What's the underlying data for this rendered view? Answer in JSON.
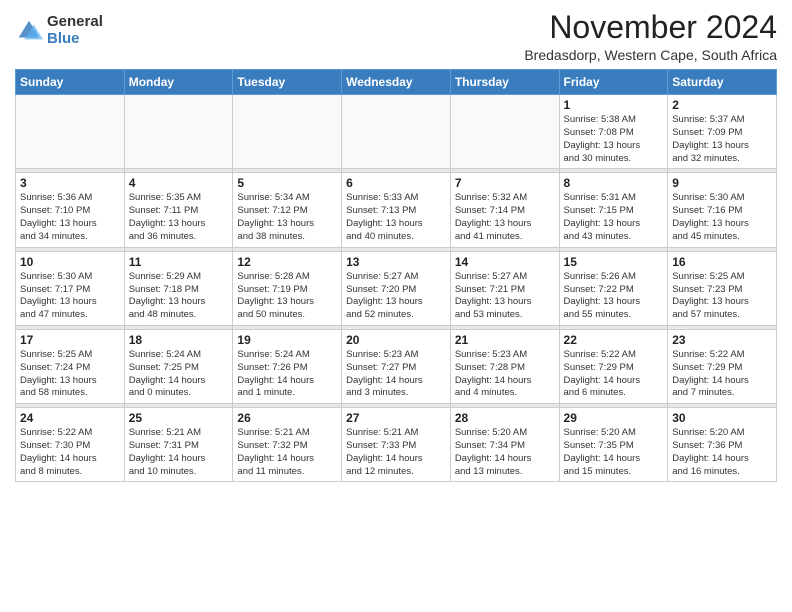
{
  "header": {
    "logo_general": "General",
    "logo_blue": "Blue",
    "month_title": "November 2024",
    "location": "Bredasdorp, Western Cape, South Africa"
  },
  "weekdays": [
    "Sunday",
    "Monday",
    "Tuesday",
    "Wednesday",
    "Thursday",
    "Friday",
    "Saturday"
  ],
  "weeks": [
    [
      {
        "day": "",
        "info": ""
      },
      {
        "day": "",
        "info": ""
      },
      {
        "day": "",
        "info": ""
      },
      {
        "day": "",
        "info": ""
      },
      {
        "day": "",
        "info": ""
      },
      {
        "day": "1",
        "info": "Sunrise: 5:38 AM\nSunset: 7:08 PM\nDaylight: 13 hours\nand 30 minutes."
      },
      {
        "day": "2",
        "info": "Sunrise: 5:37 AM\nSunset: 7:09 PM\nDaylight: 13 hours\nand 32 minutes."
      }
    ],
    [
      {
        "day": "3",
        "info": "Sunrise: 5:36 AM\nSunset: 7:10 PM\nDaylight: 13 hours\nand 34 minutes."
      },
      {
        "day": "4",
        "info": "Sunrise: 5:35 AM\nSunset: 7:11 PM\nDaylight: 13 hours\nand 36 minutes."
      },
      {
        "day": "5",
        "info": "Sunrise: 5:34 AM\nSunset: 7:12 PM\nDaylight: 13 hours\nand 38 minutes."
      },
      {
        "day": "6",
        "info": "Sunrise: 5:33 AM\nSunset: 7:13 PM\nDaylight: 13 hours\nand 40 minutes."
      },
      {
        "day": "7",
        "info": "Sunrise: 5:32 AM\nSunset: 7:14 PM\nDaylight: 13 hours\nand 41 minutes."
      },
      {
        "day": "8",
        "info": "Sunrise: 5:31 AM\nSunset: 7:15 PM\nDaylight: 13 hours\nand 43 minutes."
      },
      {
        "day": "9",
        "info": "Sunrise: 5:30 AM\nSunset: 7:16 PM\nDaylight: 13 hours\nand 45 minutes."
      }
    ],
    [
      {
        "day": "10",
        "info": "Sunrise: 5:30 AM\nSunset: 7:17 PM\nDaylight: 13 hours\nand 47 minutes."
      },
      {
        "day": "11",
        "info": "Sunrise: 5:29 AM\nSunset: 7:18 PM\nDaylight: 13 hours\nand 48 minutes."
      },
      {
        "day": "12",
        "info": "Sunrise: 5:28 AM\nSunset: 7:19 PM\nDaylight: 13 hours\nand 50 minutes."
      },
      {
        "day": "13",
        "info": "Sunrise: 5:27 AM\nSunset: 7:20 PM\nDaylight: 13 hours\nand 52 minutes."
      },
      {
        "day": "14",
        "info": "Sunrise: 5:27 AM\nSunset: 7:21 PM\nDaylight: 13 hours\nand 53 minutes."
      },
      {
        "day": "15",
        "info": "Sunrise: 5:26 AM\nSunset: 7:22 PM\nDaylight: 13 hours\nand 55 minutes."
      },
      {
        "day": "16",
        "info": "Sunrise: 5:25 AM\nSunset: 7:23 PM\nDaylight: 13 hours\nand 57 minutes."
      }
    ],
    [
      {
        "day": "17",
        "info": "Sunrise: 5:25 AM\nSunset: 7:24 PM\nDaylight: 13 hours\nand 58 minutes."
      },
      {
        "day": "18",
        "info": "Sunrise: 5:24 AM\nSunset: 7:25 PM\nDaylight: 14 hours\nand 0 minutes."
      },
      {
        "day": "19",
        "info": "Sunrise: 5:24 AM\nSunset: 7:26 PM\nDaylight: 14 hours\nand 1 minute."
      },
      {
        "day": "20",
        "info": "Sunrise: 5:23 AM\nSunset: 7:27 PM\nDaylight: 14 hours\nand 3 minutes."
      },
      {
        "day": "21",
        "info": "Sunrise: 5:23 AM\nSunset: 7:28 PM\nDaylight: 14 hours\nand 4 minutes."
      },
      {
        "day": "22",
        "info": "Sunrise: 5:22 AM\nSunset: 7:29 PM\nDaylight: 14 hours\nand 6 minutes."
      },
      {
        "day": "23",
        "info": "Sunrise: 5:22 AM\nSunset: 7:29 PM\nDaylight: 14 hours\nand 7 minutes."
      }
    ],
    [
      {
        "day": "24",
        "info": "Sunrise: 5:22 AM\nSunset: 7:30 PM\nDaylight: 14 hours\nand 8 minutes."
      },
      {
        "day": "25",
        "info": "Sunrise: 5:21 AM\nSunset: 7:31 PM\nDaylight: 14 hours\nand 10 minutes."
      },
      {
        "day": "26",
        "info": "Sunrise: 5:21 AM\nSunset: 7:32 PM\nDaylight: 14 hours\nand 11 minutes."
      },
      {
        "day": "27",
        "info": "Sunrise: 5:21 AM\nSunset: 7:33 PM\nDaylight: 14 hours\nand 12 minutes."
      },
      {
        "day": "28",
        "info": "Sunrise: 5:20 AM\nSunset: 7:34 PM\nDaylight: 14 hours\nand 13 minutes."
      },
      {
        "day": "29",
        "info": "Sunrise: 5:20 AM\nSunset: 7:35 PM\nDaylight: 14 hours\nand 15 minutes."
      },
      {
        "day": "30",
        "info": "Sunrise: 5:20 AM\nSunset: 7:36 PM\nDaylight: 14 hours\nand 16 minutes."
      }
    ]
  ]
}
